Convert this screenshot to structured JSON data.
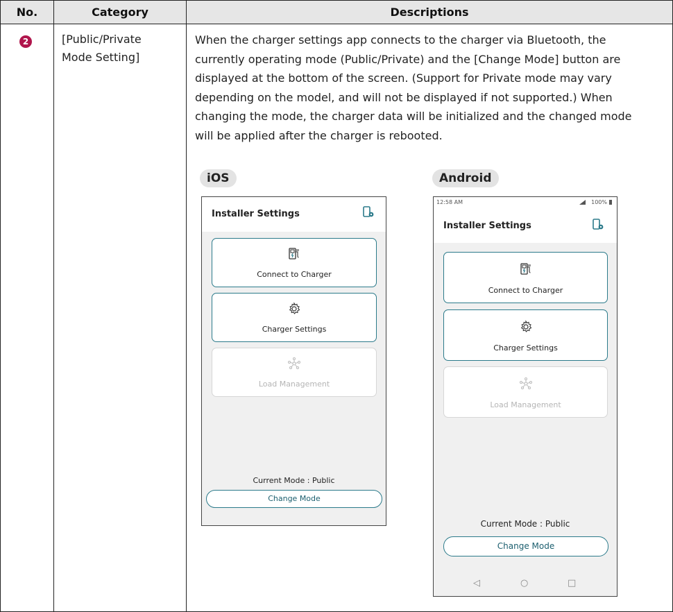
{
  "table": {
    "headers": [
      "No.",
      "Category",
      "Descriptions"
    ],
    "row": {
      "number": "2",
      "category_line1": "[Public/Private",
      "category_line2": "Mode Setting]",
      "description_lines": [
        "When the charger settings app connects to the charger via Bluetooth, the",
        "currently operating mode (Public/Private) and the [Change Mode] button are",
        "displayed at the bottom of the screen. (Support for Private mode may vary",
        "depending on the model, and will not be displayed if not supported.) When",
        "changing the mode, the charger data will be initialized and the changed mode",
        "will be applied after the charger is rebooted."
      ]
    }
  },
  "ios": {
    "label": "iOS",
    "title": "Installer Settings",
    "cards": [
      "Connect to Charger",
      "Charger Settings",
      "Load Management"
    ],
    "current_mode": "Current Mode : Public",
    "change_mode": "Change Mode"
  },
  "android": {
    "label": "Android",
    "status_time": "12:58 AM",
    "status_battery": "100%",
    "title": "Installer Settings",
    "cards": [
      "Connect to Charger",
      "Charger Settings",
      "Load Management"
    ],
    "current_mode": "Current Mode : Public",
    "change_mode": "Change Mode"
  },
  "colors": {
    "accent": "#2b7a8a",
    "badge": "#b0154c",
    "header_bg": "#e6e6e6",
    "screen_bg": "#f0f0f0",
    "disabled": "#d6d6d6"
  },
  "icons": [
    "settings-device-icon",
    "ev-charger-icon",
    "gear-icon",
    "network-nodes-icon",
    "back-triangle-icon",
    "home-circle-icon",
    "recents-square-icon",
    "signal-icon",
    "battery-icon"
  ]
}
